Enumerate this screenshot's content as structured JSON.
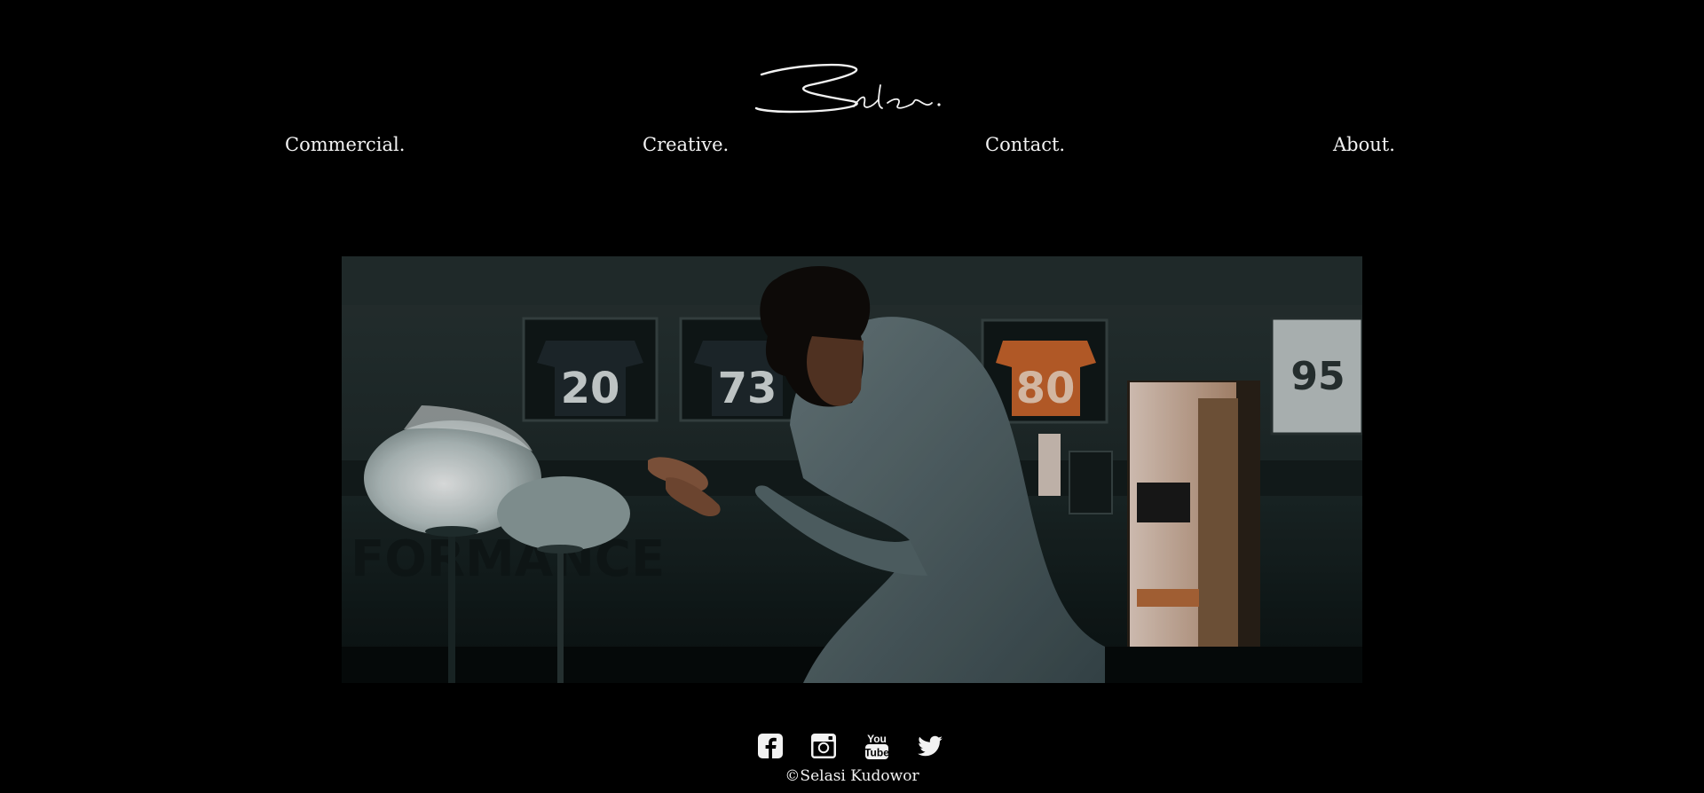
{
  "brand": {
    "logo_text": "Selasi"
  },
  "nav": {
    "items": [
      {
        "label": "Commercial."
      },
      {
        "label": "Creative."
      },
      {
        "label": "Contact."
      },
      {
        "label": "About."
      }
    ]
  },
  "hero": {
    "jersey_numbers": [
      "20",
      "73",
      "80",
      "95"
    ]
  },
  "social": {
    "icons": [
      "facebook-icon",
      "instagram-icon",
      "youtube-icon",
      "twitter-icon"
    ],
    "youtube_text_top": "You",
    "youtube_text_bottom": "Tube"
  },
  "footer": {
    "copyright": "©Selasi Kudowor"
  },
  "colors": {
    "background": "#000000",
    "text": "#f2f2f2"
  }
}
